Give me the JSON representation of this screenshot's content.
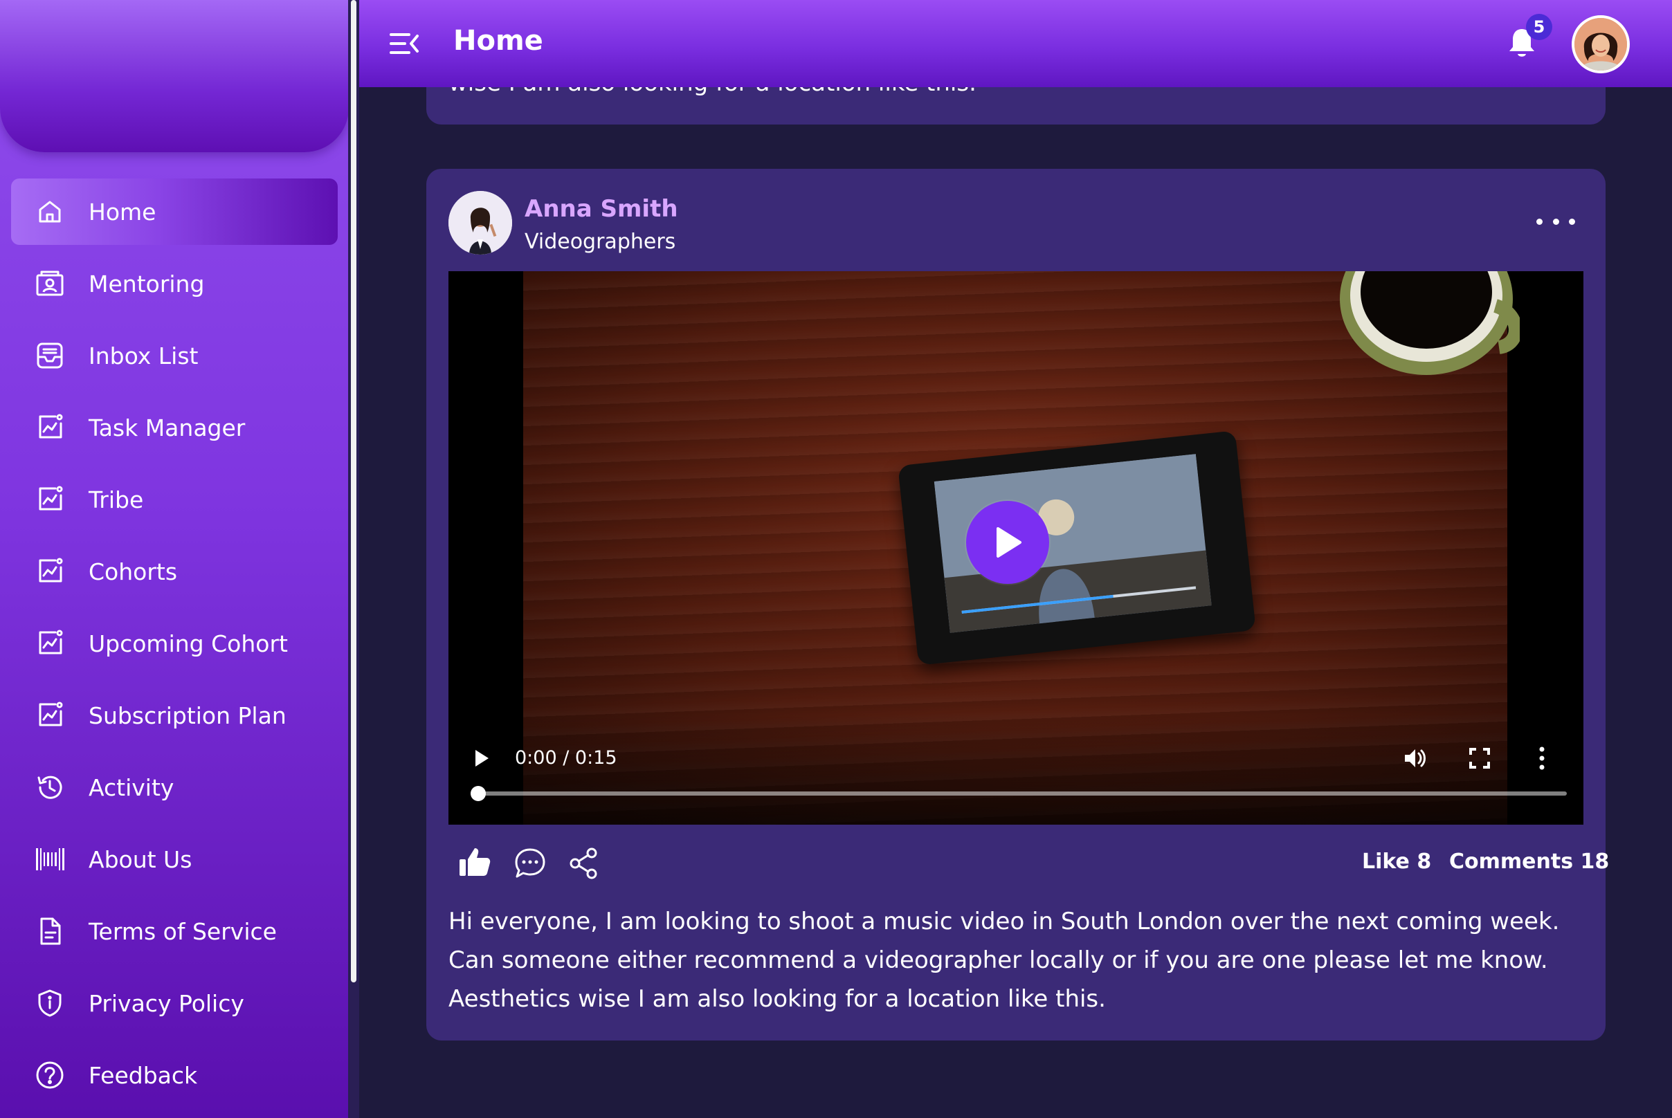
{
  "topbar": {
    "title": "Home",
    "notification_count": "5"
  },
  "sidebar": {
    "items": [
      {
        "label": "Home",
        "icon": "home-icon"
      },
      {
        "label": "Mentoring",
        "icon": "mentoring-icon"
      },
      {
        "label": "Inbox List",
        "icon": "inbox-icon"
      },
      {
        "label": "Task Manager",
        "icon": "chart-icon"
      },
      {
        "label": "Tribe",
        "icon": "chart-icon"
      },
      {
        "label": "Cohorts",
        "icon": "chart-icon"
      },
      {
        "label": "Upcoming Cohort",
        "icon": "chart-icon"
      },
      {
        "label": "Subscription Plan",
        "icon": "chart-icon"
      },
      {
        "label": "Activity",
        "icon": "history-icon"
      },
      {
        "label": "About Us",
        "icon": "barcode-icon"
      },
      {
        "label": "Terms of Service",
        "icon": "document-icon"
      },
      {
        "label": "Privacy Policy",
        "icon": "shield-icon"
      },
      {
        "label": "Feedback",
        "icon": "help-circle-icon"
      }
    ]
  },
  "previous_post": {
    "text_fragment": "wise I am also looking for a location like this."
  },
  "post": {
    "author_name": "Anna Smith",
    "author_role": "Videographers",
    "video": {
      "time": "0:00 / 0:15",
      "progress": 0
    },
    "like_label": "Like 8",
    "comments_label": "Comments 18",
    "text": "Hi everyone, I am looking to shoot a music video in South London over the next coming week. Can someone either recommend a videographer locally or if you are one please let me know. Aesthetics wise I am also looking for a location like this."
  },
  "colors": {
    "accent": "#7b2ff2",
    "sidebar_top": "#8f4dec",
    "sidebar_bottom": "#5a0fae",
    "card": "#3b2a77",
    "background": "#1e1a3d",
    "author_name": "#d9a6ff",
    "badge": "#4b2bd6"
  }
}
